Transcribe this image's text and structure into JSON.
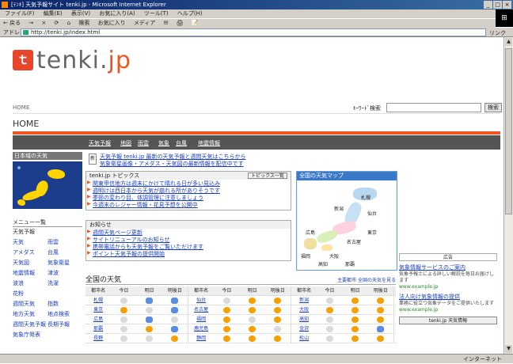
{
  "window": {
    "title": "[ﾃﾝｷ] 天気予報サイト tenki.jp - Microsoft Internet Explorer",
    "buttons": [
      "_",
      "□",
      "×"
    ]
  },
  "menubar": {
    "items": [
      "ファイル(F)",
      "編集(E)",
      "表示(V)",
      "お気に入り(A)",
      "ツール(T)",
      "ヘルプ(H)"
    ]
  },
  "toolbar": {
    "items": [
      "← 戻る",
      "→",
      "×",
      "⟳",
      "⌂",
      "検索",
      "お気に入り",
      "メディア",
      "✉",
      "🖨",
      "📝"
    ]
  },
  "address": {
    "label": "アドレス(D)",
    "value": "http://tenki.jp/index.html",
    "go": "移動",
    "links": "リンク"
  },
  "logo": {
    "mark": "ｔ",
    "text_left": "tenki.",
    "text_right": "jp"
  },
  "search": {
    "home": "HOME",
    "label": "ｷｰﾜｰﾄﾞ検索",
    "placeholder": "",
    "button": "検索"
  },
  "page": {
    "heading": "HOME"
  },
  "nav": {
    "items": [
      "天気予報",
      "地図",
      "雨雲",
      "気象",
      "台風",
      "地震情報"
    ]
  },
  "left": {
    "map_title": "日本域の天気",
    "menu_title": "メニュー一覧",
    "menu_sub": "天気予報",
    "menu": [
      [
        "天気",
        "雨雲"
      ],
      [
        "アメダス",
        "台風"
      ],
      [
        "天気図",
        "気象衛星"
      ],
      [
        "地震情報",
        "津波"
      ],
      [
        "波浪",
        "洗濯"
      ],
      [
        "花粉",
        ""
      ],
      [
        "週間天気",
        "指数"
      ],
      [
        "地方天気",
        "地点検索"
      ],
      [
        "週間天気予報",
        "長期予報"
      ],
      [
        "気象庁発表",
        ""
      ]
    ]
  },
  "main": {
    "news": [
      "天気予報 tenki.jp 最新の天気予報と週間天気はこちらから",
      "気象衛星画像・アメダス・天気図の最新情報を配信中です"
    ],
    "topics_title": "tenki.jp トピックス",
    "topics_more": "トピックス一覧",
    "topics": [
      "関東甲信地方は週末にかけて晴れる日が多い見込み",
      "週明けは西日本から天気が崩れる所がありそうです",
      "季節の変わり目、体調管理に注意しましょう",
      "今週末のレジャー情報・花見予想を公開中"
    ],
    "notice_title": "お知らせ",
    "notice": [
      "週間天気ページ更新",
      "サイトリニューアルのお知らせ",
      "携帯電話からも天気予報をご覧いただけます",
      "ポイント天気予報の提供開始"
    ],
    "jpmap_title": "全国の天気マップ",
    "cities": [
      "札幌",
      "仙台",
      "新潟",
      "東京",
      "名古屋",
      "大阪",
      "広島",
      "福岡",
      "高知",
      "那覇"
    ],
    "forecast_title": "全国の天気",
    "forecast_link": "主要都市 全国の天気を見る",
    "table_headers": [
      "都市名",
      "今日",
      "明日",
      "明後日"
    ],
    "rows": [
      [
        "札幌",
        "cloud",
        "rain",
        "rain",
        "仙台",
        "cloud",
        "sun",
        "sun",
        "新潟",
        "cloud",
        "sun",
        "sun"
      ],
      [
        "東京",
        "sun",
        "cloud",
        "rain",
        "名古屋",
        "sun",
        "sun",
        "sun",
        "大阪",
        "sun",
        "sun",
        "sun"
      ],
      [
        "広島",
        "cloud",
        "rain",
        "cloud",
        "福岡",
        "sun",
        "cloud",
        "sun",
        "高知",
        "cloud",
        "sun",
        "sun"
      ],
      [
        "那覇",
        "cloud",
        "sun",
        "rain",
        "鹿児島",
        "sun",
        "sun",
        "cloud",
        "金沢",
        "cloud",
        "sun",
        "rain"
      ],
      [
        "長野",
        "cloud",
        "cloud",
        "sun",
        "静岡",
        "sun",
        "sun",
        "sun",
        "松山",
        "cloud",
        "sun",
        "sun"
      ]
    ]
  },
  "right": {
    "ad_label": "広告",
    "links": [
      {
        "title": "気象情報サービスのご案内",
        "text": "気象予報士による詳しい解説を毎日お届けします",
        "url": "www.example.jp"
      },
      {
        "title": "法人向け気象情報の提供",
        "text": "業務に役立つ気象データをご提供いたします",
        "url": "www.example.jp"
      }
    ],
    "bottom_button": "tenki.jp 天気情報"
  },
  "status": {
    "text": "",
    "zone": "インターネット"
  }
}
